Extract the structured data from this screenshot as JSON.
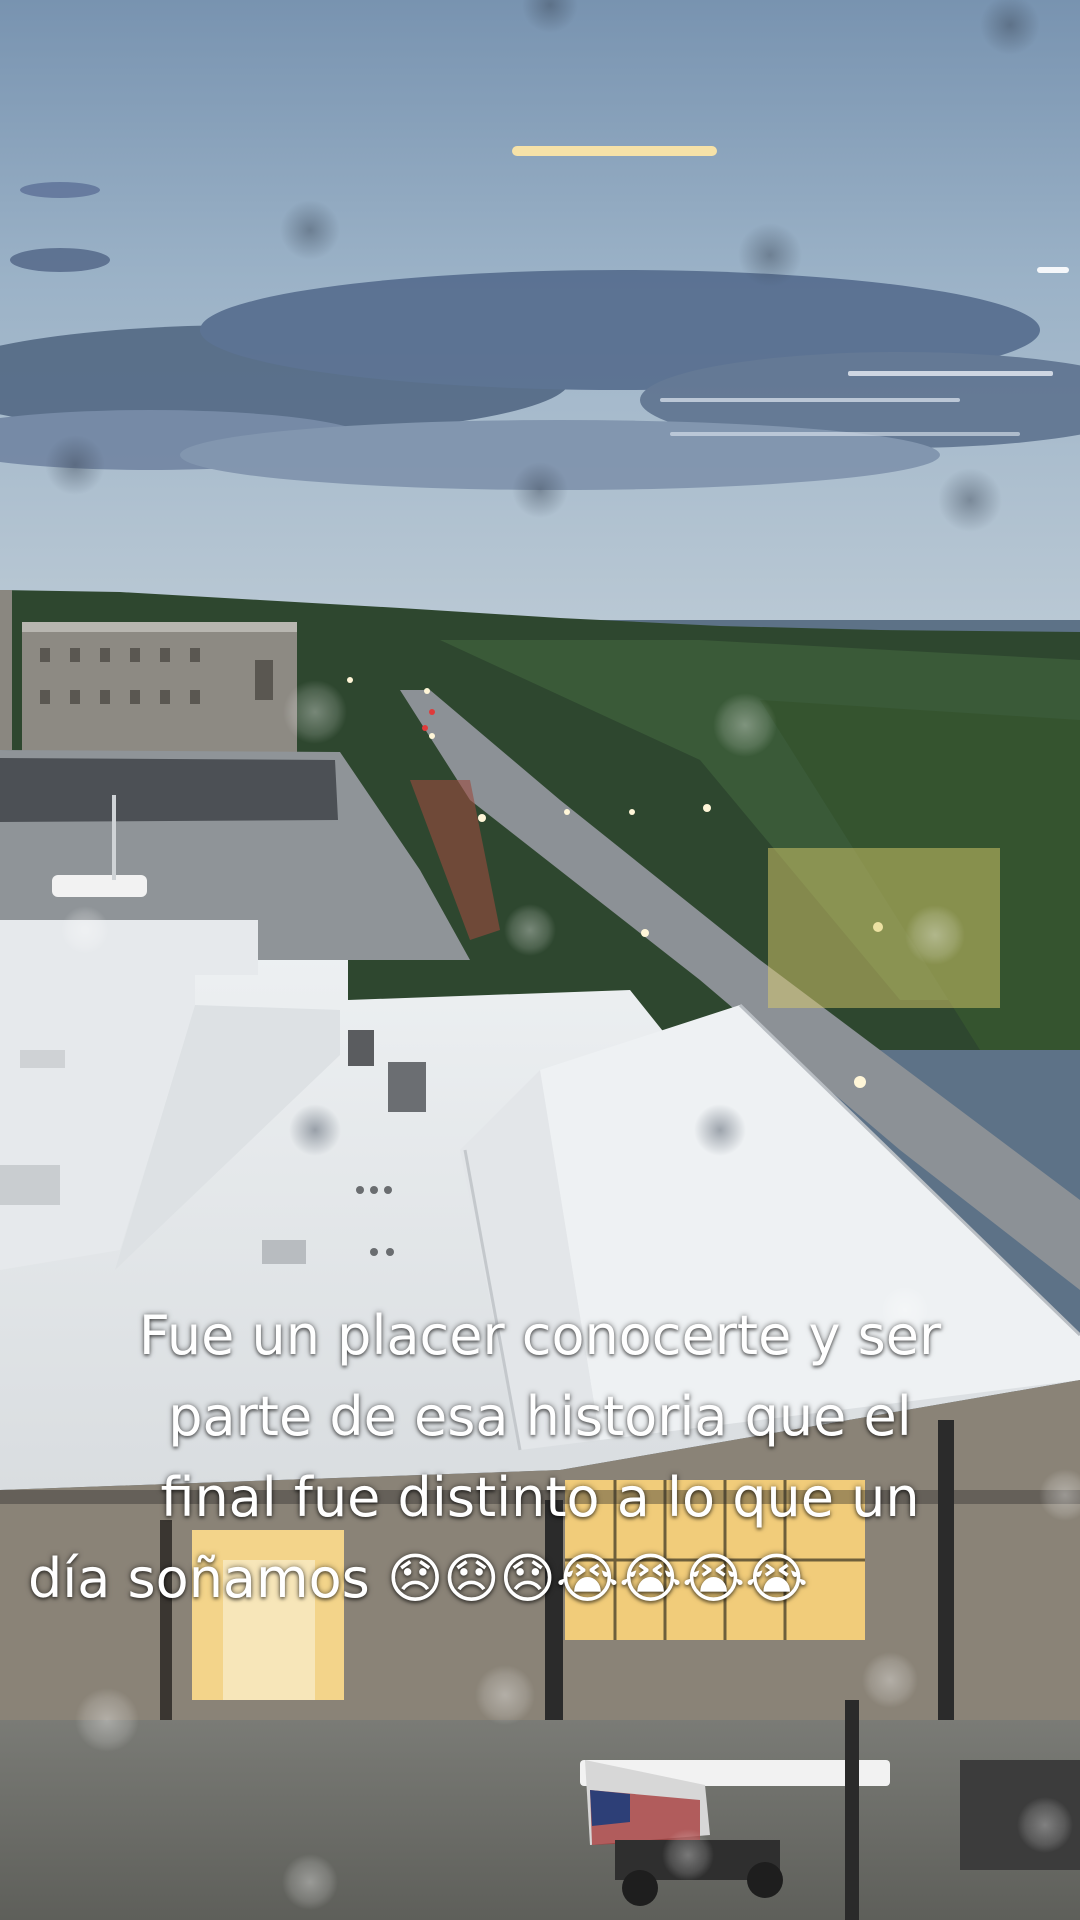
{
  "caption": {
    "line1": "Fue un placer conocerte y ser",
    "line2": "parte de esa historia que el",
    "line3": "final fue distinto a lo que un",
    "line4": "día soñamos 😞😞😞😭😭😭😭"
  },
  "scene": {
    "description_icons": [
      "sky-region",
      "treeline",
      "rooftop",
      "street",
      "construction-lift",
      "rain-droplets"
    ]
  },
  "colors": {
    "sky_top": "#7f9bb6",
    "sky_bottom": "#b7c6d3",
    "clouds": "#4b5f78",
    "trees": "#2f4a32",
    "roof": "#e9ecef",
    "road": "#8a8f93",
    "lot": "#9aa0a4",
    "ground": "#6b6d68",
    "window_glow": "#f3d48a",
    "caption_text": "#ffffff"
  }
}
